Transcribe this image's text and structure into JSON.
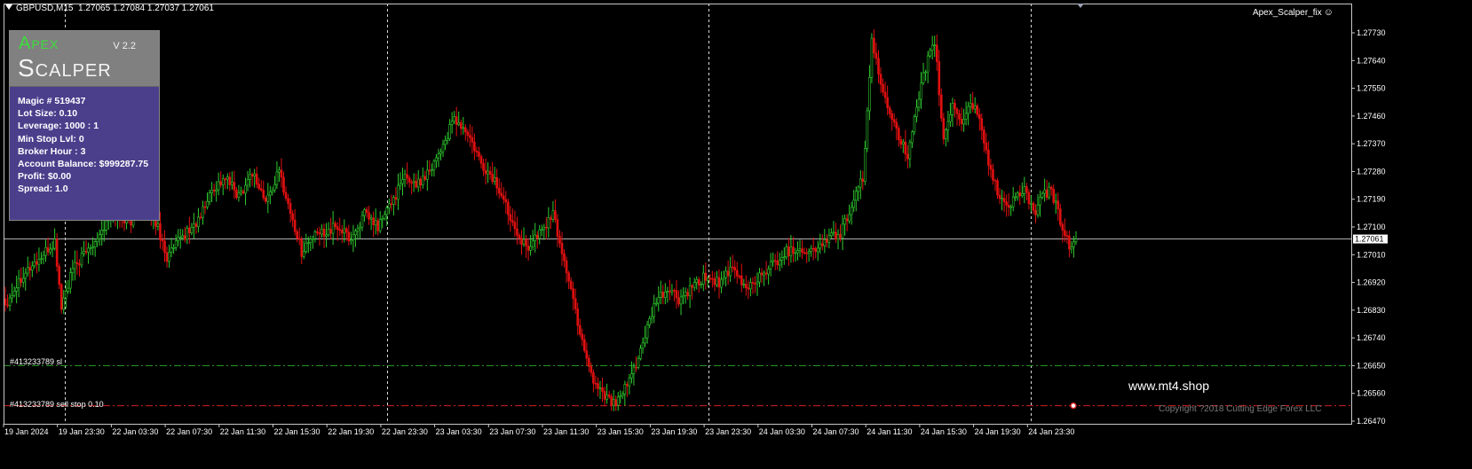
{
  "header": {
    "symbol": "GBPUSD,M15",
    "ohlc": "1.27065 1.27084 1.27037 1.27061"
  },
  "ea_label": "Apex_Scalper_fix",
  "panel": {
    "title1": "Apex",
    "title2": "Scalper",
    "version": "V 2.2",
    "lines": [
      "Magic # 519437",
      "Lot Size: 0.10",
      "Leverage: 1000 : 1",
      "Min Stop Lvl: 0",
      "Broker Hour : 3",
      "Account Balance: $999287.75",
      "Profit: $0.00",
      "Spread:  1.0"
    ]
  },
  "orders": {
    "sl_label": "#413233789 sl",
    "stop_label": "#413233789 sell stop 0.10"
  },
  "watermark": "www.mt4.shop",
  "copyright": "Copyright ?2018 Cutting Edge Forex LLC",
  "colors": {
    "bull": "#2ecc2e",
    "bear": "#e01010",
    "background": "#000000",
    "panel": "#4b3f8c",
    "sl_line": "#2aa22a",
    "stop_line": "#d02020"
  },
  "chart_data": {
    "type": "candlestick",
    "symbol": "GBPUSD",
    "timeframe": "M15",
    "current_price": "1.27061",
    "price_ticks": [
      "1.27730",
      "1.27640",
      "1.27550",
      "1.27460",
      "1.27370",
      "1.27280",
      "1.27190",
      "1.27100",
      "1.27010",
      "1.26920",
      "1.26830",
      "1.26740",
      "1.26650",
      "1.26560",
      "1.26470"
    ],
    "time_ticks": [
      "19 Jan 2024",
      "19 Jan 23:30",
      "22 Jan 03:30",
      "22 Jan 07:30",
      "22 Jan 11:30",
      "22 Jan 15:30",
      "22 Jan 19:30",
      "22 Jan 23:30",
      "23 Jan 03:30",
      "23 Jan 07:30",
      "23 Jan 11:30",
      "23 Jan 15:30",
      "23 Jan 19:30",
      "23 Jan 23:30",
      "24 Jan 03:30",
      "24 Jan 07:30",
      "24 Jan 11:30",
      "24 Jan 15:30",
      "24 Jan 19:30",
      "24 Jan 23:30"
    ],
    "sl_price": 1.2665,
    "sell_stop_price": 1.2652,
    "ylim": [
      1.2647,
      1.2778
    ],
    "anchors": [
      [
        0,
        1.2685
      ],
      [
        8,
        1.2695
      ],
      [
        16,
        1.27
      ],
      [
        22,
        1.2705
      ],
      [
        25,
        1.2684
      ],
      [
        30,
        1.2696
      ],
      [
        36,
        1.2702
      ],
      [
        42,
        1.2708
      ],
      [
        48,
        1.2714
      ],
      [
        56,
        1.2712
      ],
      [
        62,
        1.2718
      ],
      [
        68,
        1.271
      ],
      [
        72,
        1.27
      ],
      [
        78,
        1.2706
      ],
      [
        86,
        1.2712
      ],
      [
        92,
        1.2722
      ],
      [
        98,
        1.2726
      ],
      [
        104,
        1.272
      ],
      [
        110,
        1.2728
      ],
      [
        116,
        1.2718
      ],
      [
        122,
        1.2728
      ],
      [
        128,
        1.2712
      ],
      [
        132,
        1.2702
      ],
      [
        136,
        1.2706
      ],
      [
        140,
        1.2708
      ],
      [
        148,
        1.271
      ],
      [
        154,
        1.2706
      ],
      [
        160,
        1.2714
      ],
      [
        166,
        1.271
      ],
      [
        172,
        1.2718
      ],
      [
        178,
        1.2726
      ],
      [
        184,
        1.2724
      ],
      [
        190,
        1.273
      ],
      [
        196,
        1.2738
      ],
      [
        200,
        1.2745
      ],
      [
        206,
        1.274
      ],
      [
        212,
        1.273
      ],
      [
        218,
        1.2725
      ],
      [
        226,
        1.2712
      ],
      [
        232,
        1.2703
      ],
      [
        238,
        1.2708
      ],
      [
        244,
        1.2714
      ],
      [
        250,
        1.2696
      ],
      [
        256,
        1.2676
      ],
      [
        262,
        1.266
      ],
      [
        268,
        1.2655
      ],
      [
        272,
        1.2652
      ],
      [
        278,
        1.266
      ],
      [
        284,
        1.2672
      ],
      [
        290,
        1.2686
      ],
      [
        296,
        1.269
      ],
      [
        300,
        1.2686
      ],
      [
        306,
        1.269
      ],
      [
        312,
        1.2694
      ],
      [
        318,
        1.2692
      ],
      [
        324,
        1.2696
      ],
      [
        330,
        1.269
      ],
      [
        336,
        1.2694
      ],
      [
        342,
        1.2698
      ],
      [
        348,
        1.2702
      ],
      [
        354,
        1.2703
      ],
      [
        360,
        1.2702
      ],
      [
        366,
        1.2706
      ],
      [
        372,
        1.2708
      ],
      [
        378,
        1.2718
      ],
      [
        382,
        1.2726
      ],
      [
        386,
        1.277
      ],
      [
        390,
        1.2756
      ],
      [
        394,
        1.2748
      ],
      [
        398,
        1.274
      ],
      [
        402,
        1.2732
      ],
      [
        406,
        1.2748
      ],
      [
        410,
        1.2762
      ],
      [
        414,
        1.277
      ],
      [
        418,
        1.2738
      ],
      [
        422,
        1.275
      ],
      [
        426,
        1.2744
      ],
      [
        430,
        1.275
      ],
      [
        434,
        1.2746
      ],
      [
        438,
        1.273
      ],
      [
        442,
        1.2722
      ],
      [
        446,
        1.2716
      ],
      [
        450,
        1.272
      ],
      [
        454,
        1.2722
      ],
      [
        458,
        1.2714
      ],
      [
        462,
        1.272
      ],
      [
        466,
        1.2722
      ],
      [
        470,
        1.2712
      ],
      [
        474,
        1.2704
      ],
      [
        477,
        1.2706
      ]
    ]
  }
}
